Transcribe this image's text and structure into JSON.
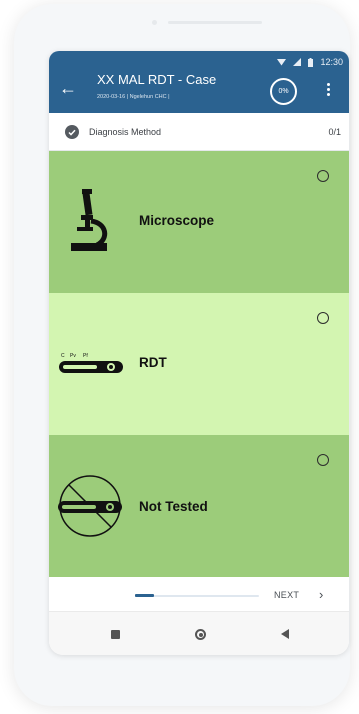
{
  "status": {
    "time": "12:30"
  },
  "appbar": {
    "title": "XX MAL RDT - Case",
    "subtitle": "2020-03-16 | Ngelehun CHC |",
    "progress": "0%"
  },
  "question": {
    "label": "Diagnosis Method",
    "count": "0/1"
  },
  "options": [
    {
      "label": "Microscope",
      "icon": "microscope-icon",
      "color": "#9ccc7a",
      "selected": false
    },
    {
      "label": "RDT",
      "icon": "rdt-cassette-icon",
      "color": "#d3f5b1",
      "selected": false
    },
    {
      "label": "Not Tested",
      "icon": "not-tested-icon",
      "color": "#9ccc7a",
      "selected": false
    }
  ],
  "footer": {
    "next_label": "NEXT",
    "page_progress": 0.15
  },
  "colors": {
    "appbar": "#2b6290",
    "option_default": "#9ccc7a",
    "option_highlight": "#d3f5b1"
  }
}
